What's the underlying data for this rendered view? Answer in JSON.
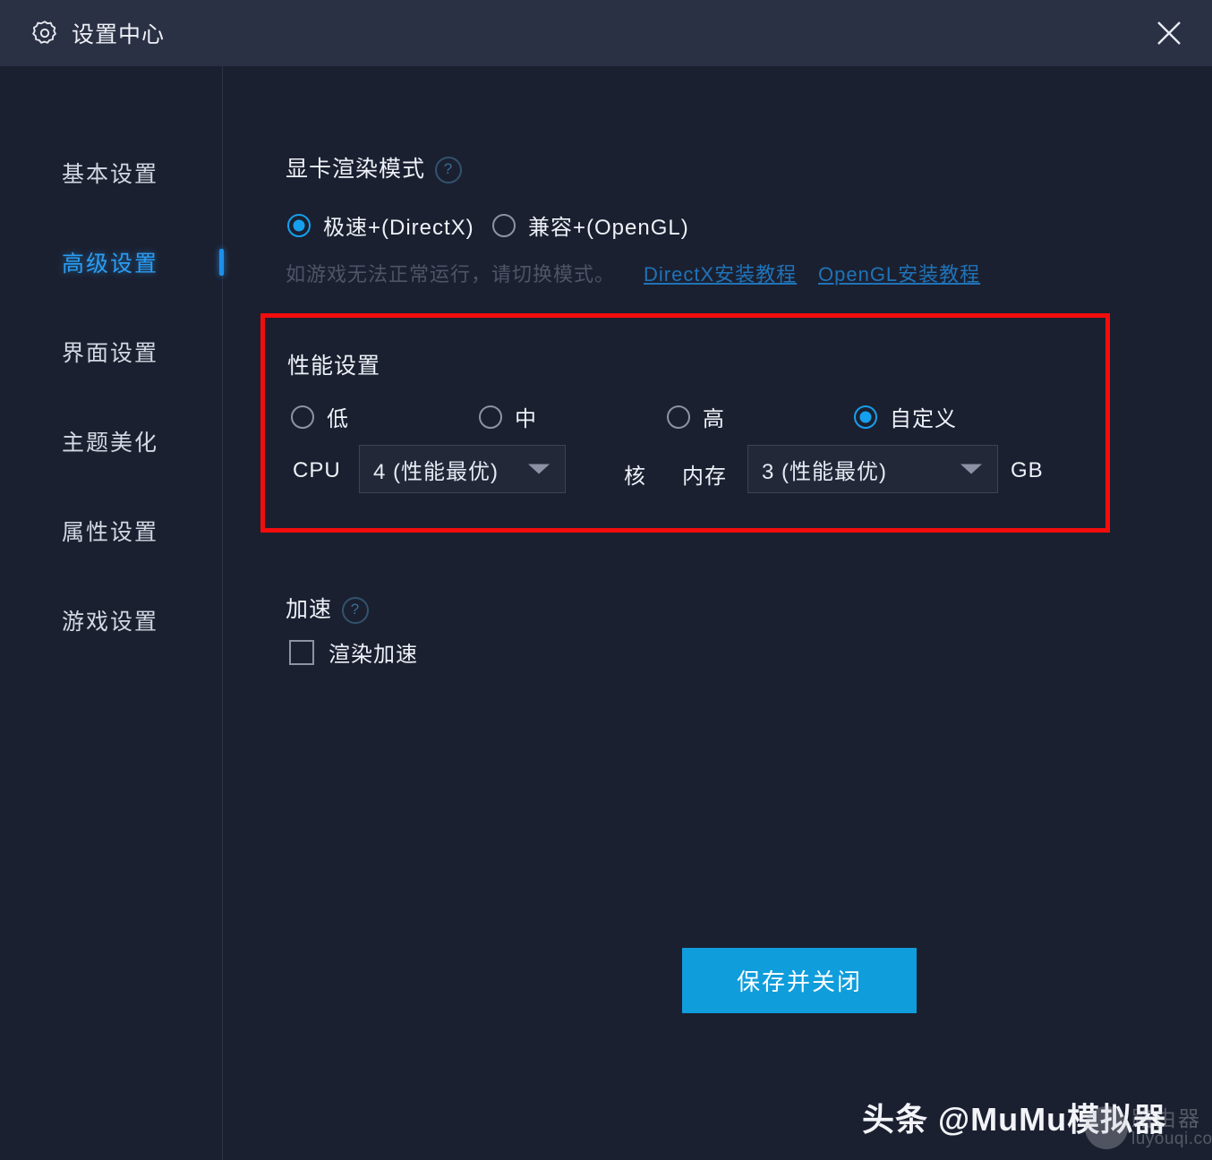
{
  "window": {
    "title": "设置中心",
    "gear_icon": "gear-icon",
    "close_icon": "close-icon"
  },
  "sidebar": {
    "items": [
      {
        "label": "基本设置",
        "active": false
      },
      {
        "label": "高级设置",
        "active": true
      },
      {
        "label": "界面设置",
        "active": false
      },
      {
        "label": "主题美化",
        "active": false
      },
      {
        "label": "属性设置",
        "active": false
      },
      {
        "label": "游戏设置",
        "active": false
      }
    ]
  },
  "render_mode": {
    "title": "显卡渲染模式",
    "help_icon": "?",
    "options": [
      {
        "label": "极速+(DirectX)",
        "selected": true
      },
      {
        "label": "兼容+(OpenGL)",
        "selected": false
      }
    ],
    "hint": "如游戏无法正常运行，请切换模式。",
    "links": [
      {
        "label": "DirectX安装教程"
      },
      {
        "label": "OpenGL安装教程"
      }
    ]
  },
  "performance": {
    "title": "性能设置",
    "options": [
      {
        "label": "低",
        "selected": false
      },
      {
        "label": "中",
        "selected": false
      },
      {
        "label": "高",
        "selected": false
      },
      {
        "label": "自定义",
        "selected": true
      }
    ],
    "cpu_label": "CPU",
    "cpu_value": "4 (性能最优)",
    "cpu_unit": "核",
    "mem_label": "内存",
    "mem_value": "3 (性能最优)",
    "mem_unit": "GB",
    "highlight_color": "#f20d0d"
  },
  "acceleration": {
    "title": "加速",
    "help_icon": "?",
    "checkbox_label": "渲染加速",
    "checked": false
  },
  "footer": {
    "save_label": "保存并关闭",
    "save_color": "#109ddb"
  },
  "watermark": {
    "text": "头条 @MuMu模拟器",
    "logo_cn": "路由器",
    "logo_url": "luyouqi.com"
  }
}
